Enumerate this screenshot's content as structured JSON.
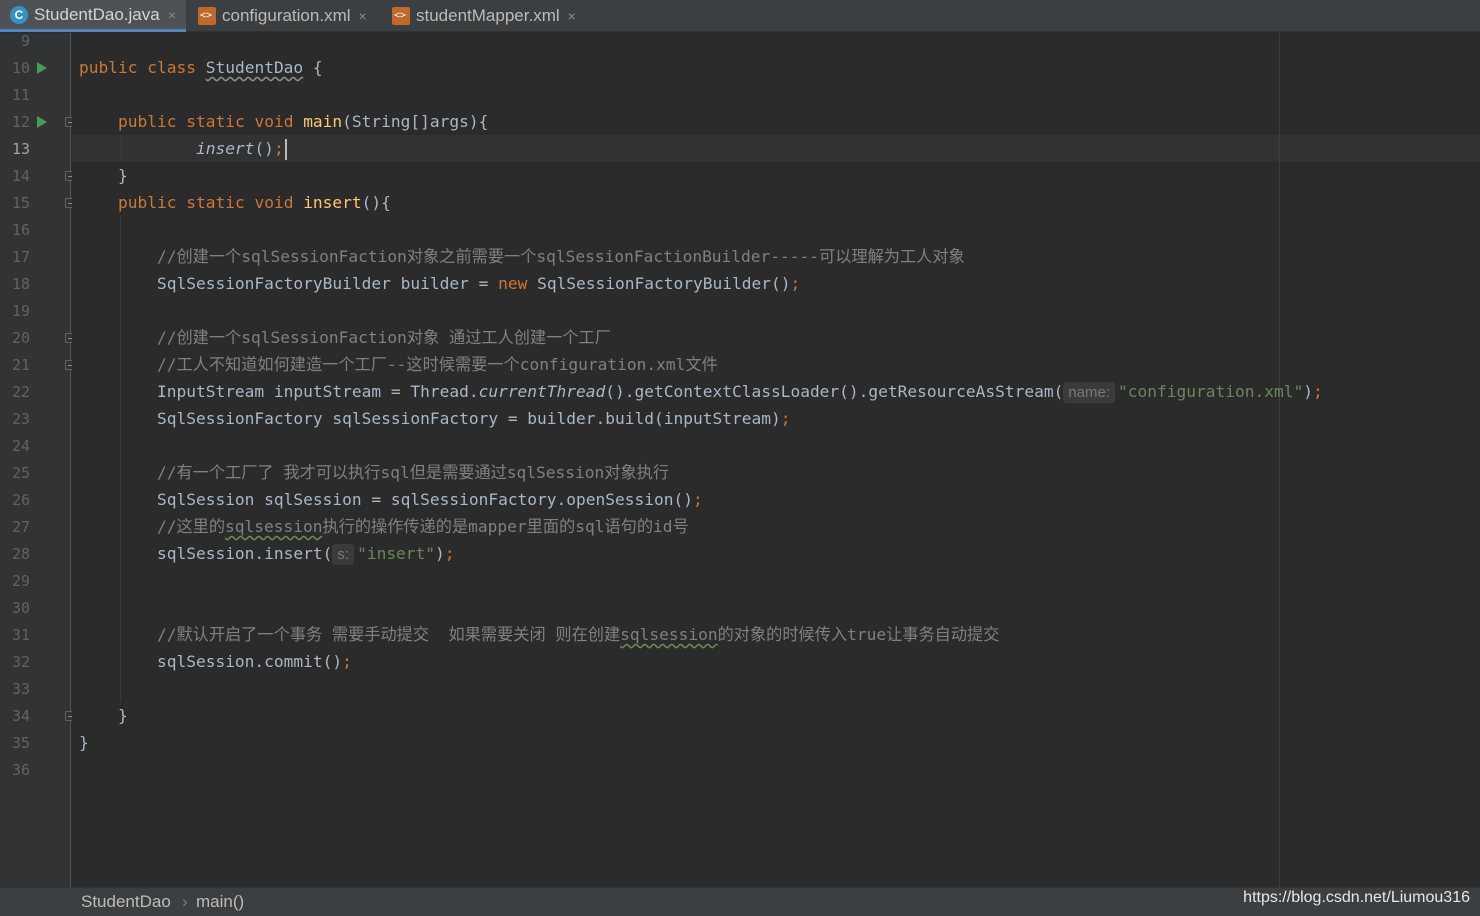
{
  "tabs": [
    {
      "label": "StudentDao.java",
      "icon": "java-class-icon",
      "active": true
    },
    {
      "label": "configuration.xml",
      "icon": "xml-file-icon",
      "active": false
    },
    {
      "label": "studentMapper.xml",
      "icon": "xml-file-icon",
      "active": false
    }
  ],
  "close_glyph": "×",
  "java_icon_glyph": "C",
  "editor": {
    "current_line": 13,
    "line_numbers": [
      "9",
      "10",
      "11",
      "12",
      "13",
      "14",
      "15",
      "16",
      "17",
      "18",
      "19",
      "20",
      "21",
      "22",
      "23",
      "24",
      "25",
      "26",
      "27",
      "28",
      "29",
      "30",
      "31",
      "32",
      "33",
      "34",
      "35",
      "36"
    ],
    "code": {
      "l10_public": "public",
      "l10_class": "class",
      "l10_name": "StudentDao",
      "l10_brace": " {",
      "l12_public": "public",
      "l12_static": "static",
      "l12_void": "void",
      "l12_main": "main",
      "l12_args": "(String[]args){",
      "l13_insert": "insert",
      "l13_paren": "()",
      "l13_semi": ";",
      "l14": "}",
      "l15_public": "public",
      "l15_static": "static",
      "l15_void": "void",
      "l15_insert": "insert",
      "l15_rest": "(){",
      "l17": "//创建一个sqlSessionFaction对象之前需要一个sqlSessionFactionBuilder-----可以理解为工人对象",
      "l18_a": "SqlSessionFactoryBuilder builder = ",
      "l18_new": "new",
      "l18_b": " SqlSessionFactoryBuilder()",
      "l18_semi": ";",
      "l20": "//创建一个sqlSessionFaction对象 通过工人创建一个工厂",
      "l21": "//工人不知道如何建造一个工厂--这时候需要一个configuration.xml文件",
      "l22_a": "InputStream inputStream = Thread.",
      "l22_ct": "currentThread",
      "l22_b": "().getContextClassLoader().getResourceAsStream(",
      "l22_hint": "name:",
      "l22_str": "\"configuration.xml\"",
      "l22_c": ")",
      "l22_semi": ";",
      "l23_a": "SqlSessionFactory sqlSessionFactory = builder.build(inputStream)",
      "l23_semi": ";",
      "l25": "//有一个工厂了 我才可以执行sql但是需要通过sqlSession对象执行",
      "l26_a": "SqlSession sqlSession = sqlSessionFactory.openSession()",
      "l26_semi": ";",
      "l27_a": "//这里的",
      "l27_ul": "sqlsession",
      "l27_b": "执行的操作传递的是mapper里面的sql语句的id号",
      "l28_a": "sqlSession.insert(",
      "l28_hint": "s:",
      "l28_str": "\"insert\"",
      "l28_b": ")",
      "l28_semi": ";",
      "l31_a": "//默认开启了一个事务 需要手动提交  如果需要关闭 则在创建",
      "l31_ul": "sqlsession",
      "l31_b": "的对象的时候传入true让事务自动提交",
      "l32_a": "sqlSession.commit()",
      "l32_semi": ";",
      "l34": "}",
      "l35": "}"
    }
  },
  "breadcrumb": {
    "class_name": "StudentDao",
    "separator": "›",
    "method": "main()"
  },
  "watermark": "https://blog.csdn.net/Liumou316",
  "colors": {
    "keyword": "#cc7832",
    "method_decl": "#ffc66d",
    "string": "#6a8759",
    "comment": "#808080",
    "text": "#a9b7c6",
    "background": "#2b2b2b"
  }
}
